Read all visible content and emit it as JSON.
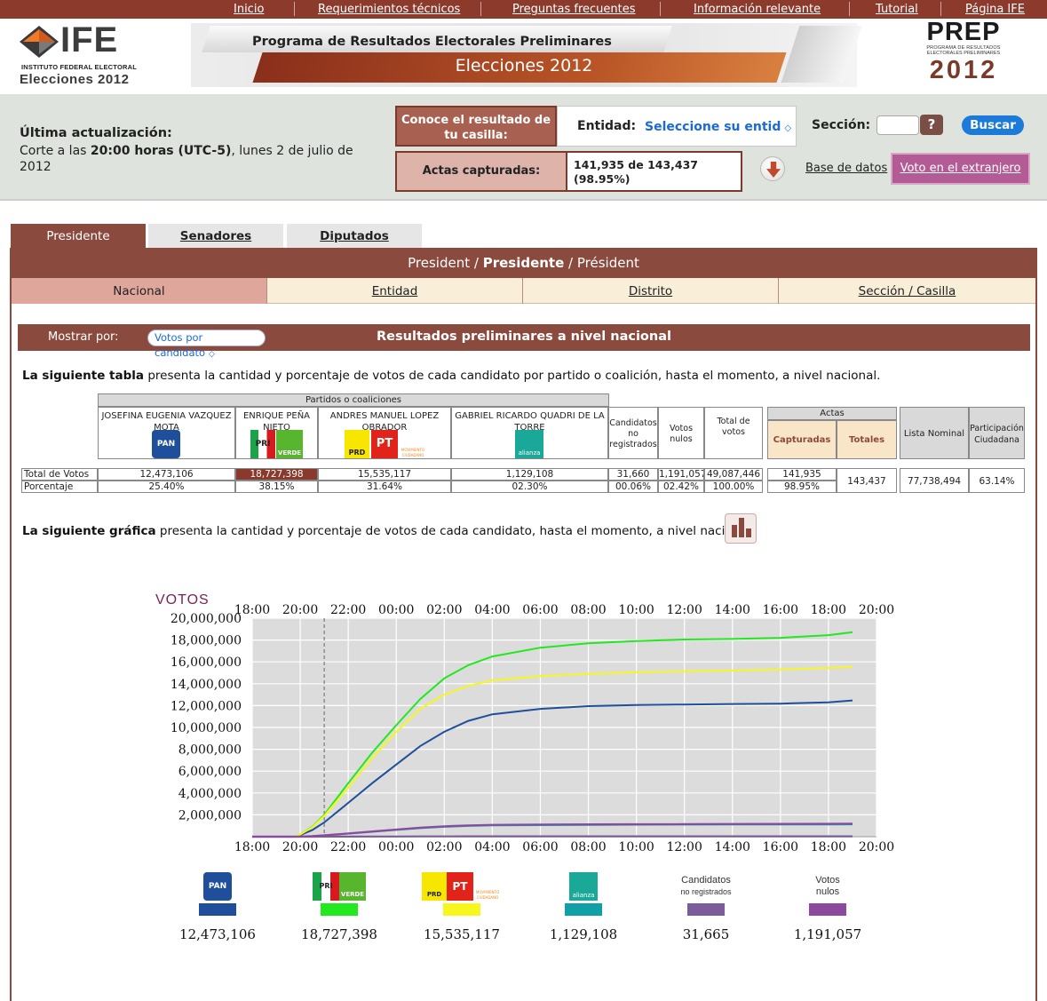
{
  "nav": {
    "inicio": "Inicio",
    "requerimientos": "Requerimientos técnicos",
    "preguntas": "Preguntas frecuentes",
    "informacion": "Información relevante",
    "tutorial": "Tutorial",
    "pagina_ife": "Página IFE"
  },
  "header": {
    "ife_logo_text": "IFE",
    "ife_subtitle": "INSTITUTO FEDERAL ELECTORAL",
    "ife_year": "Elecciones 2012",
    "banner_title": "Programa de Resultados Electorales Preliminares",
    "banner_subtitle": "Elecciones 2012",
    "prep_word": "PREP",
    "prep_sub1": "PROGRAMA DE RESULTADOS",
    "prep_sub2": "ELECTORALES PRELIMINARES",
    "prep_year": "2012"
  },
  "status": {
    "title": "Última actualización:",
    "corte_prefix": "Corte a las ",
    "hora": "20:00 horas (UTC-5)",
    "fecha": ", lunes 2 de julio de 2012",
    "conoce": "Conoce el resultado de tu casilla:",
    "entidad_label": "Entidad:",
    "entidad_select": "Seleccione su entid",
    "seccion_label": "Sección:",
    "help": "?",
    "buscar": "Buscar",
    "actas_label": "Actas capturadas:",
    "actas_value": "141,935 de 143,437",
    "actas_pct": "(98.95%)",
    "base_datos": "Base de datos",
    "voto_extranjero": "Voto en el extranjero"
  },
  "tabs": [
    "Presidente",
    "Senadores",
    "Diputados"
  ],
  "pres_header": {
    "a": "President / ",
    "b": "Presidente",
    "c": " / Président"
  },
  "subtabs": [
    "Nacional",
    "Entidad",
    "Distrito",
    "Sección / Casilla"
  ],
  "results_bar": {
    "mostrar_label": "Mostrar por:",
    "mostrar_value": "Votos por candidato",
    "title": "Resultados preliminares a nivel nacional"
  },
  "intro_table": {
    "bold": "La siguiente tabla",
    "rest": " presenta la cantidad y porcentaje de votos de cada candidato por partido o coalición, hasta el momento, a nivel nacional."
  },
  "intro_chart": {
    "bold": "La siguiente gráfica",
    "rest": " presenta la cantidad y porcentaje de votos de cada candidato, hasta el momento, a nivel nacional."
  },
  "table": {
    "group_header": "Partidos o coaliciones",
    "actas_header": "Actas",
    "candidates": [
      {
        "name": "JOSEFINA EUGENIA VAZQUEZ MOTA",
        "votes": "12,473,106",
        "pct": "25.40%"
      },
      {
        "name": "ENRIQUE PEÑA NIETO",
        "votes": "18,727,398",
        "pct": "38.15%"
      },
      {
        "name": "ANDRES MANUEL LOPEZ OBRADOR",
        "votes": "15,535,117",
        "pct": "31.64%"
      },
      {
        "name": "GABRIEL RICARDO QUADRI DE LA TORRE",
        "votes": "1,129,108",
        "pct": "02.30%"
      }
    ],
    "no_registrados": {
      "label": "Candidatos no registrados",
      "votes": "31,660",
      "pct": "00.06%"
    },
    "nulos": {
      "label": "Votos nulos",
      "votes": "1,191,057",
      "pct": "02.42%"
    },
    "total": {
      "label": "Total de votos",
      "votes": "49,087,446",
      "pct": "100.00%"
    },
    "capturadas": {
      "label": "Capturadas",
      "value": "141,935",
      "pct": "98.95%"
    },
    "totales": {
      "label": "Totales",
      "value": "143,437"
    },
    "lista_nominal": {
      "label": "Lista Nominal",
      "value": "77,738,494"
    },
    "participacion": {
      "label": "Participación Ciudadana",
      "value": "63.14%"
    },
    "row_total_label": "Total de Votos",
    "row_pct_label": "Porcentaje"
  },
  "party_logos": {
    "pan": "PAN",
    "pri": "PRI",
    "verde": "VERDE",
    "prd": "PRD",
    "pt": "PT",
    "mc": "MOVIMIENTO CIUDADANO",
    "alianza": "alianza"
  },
  "colors": {
    "pan": "#1f4f9a",
    "pri": "#22e81e",
    "prd": "#f7f71d",
    "panal": "#12a0a8",
    "no_reg": "#7a5c9a",
    "nulos": "#8a4aa0",
    "brand": "#8a4a3e"
  },
  "chart_data": {
    "type": "line",
    "ylabel": "VOTOS",
    "ylim": [
      0,
      20000000
    ],
    "yticks": [
      "2,000,000",
      "4,000,000",
      "6,000,000",
      "8,000,000",
      "10,000,000",
      "12,000,000",
      "14,000,000",
      "16,000,000",
      "18,000,000",
      "20,000,000"
    ],
    "xticks": [
      "18:00",
      "20:00",
      "22:00",
      "00:00",
      "02:00",
      "04:00",
      "06:00",
      "08:00",
      "10:00",
      "12:00",
      "14:00",
      "16:00",
      "18:00",
      "20:00",
      "22:00"
    ],
    "grid": true,
    "x_hours": [
      0,
      2,
      3.5,
      4,
      5,
      6,
      8,
      10,
      12,
      14,
      16,
      18,
      20,
      24,
      28,
      32,
      36,
      40,
      44,
      48,
      50
    ],
    "series": [
      {
        "values": [
          0,
          0,
          0,
          150000,
          600000,
          1300000,
          3100000,
          4900000,
          6600000,
          8300000,
          9600000,
          10600000,
          11200000,
          11700000,
          11950000,
          12050000,
          12100000,
          12150000,
          12180000,
          12300000,
          12473106
        ],
        "color": "#1f4f9a"
      },
      {
        "values": [
          0,
          0,
          0,
          200000,
          900000,
          2000000,
          4900000,
          7700000,
          10200000,
          12600000,
          14500000,
          15700000,
          16500000,
          17300000,
          17700000,
          17900000,
          18050000,
          18100000,
          18200000,
          18450000,
          18727398
        ],
        "color": "#22e81e"
      },
      {
        "values": [
          0,
          0,
          0,
          200000,
          850000,
          1900000,
          4500000,
          7200000,
          9600000,
          11700000,
          13000000,
          13800000,
          14300000,
          14700000,
          14900000,
          15050000,
          15150000,
          15200000,
          15300000,
          15450000,
          15535117
        ],
        "color": "#f7f71d"
      },
      {
        "values": [
          0,
          0,
          0,
          10000,
          50000,
          120000,
          280000,
          450000,
          620000,
          780000,
          900000,
          980000,
          1030000,
          1060000,
          1080000,
          1095000,
          1105000,
          1110000,
          1115000,
          1120000,
          1129108
        ],
        "color": "#12a0a8"
      },
      {
        "values": [
          0,
          0,
          0,
          0,
          2000,
          5000,
          10000,
          15000,
          20000,
          24000,
          27000,
          29000,
          30000,
          30500,
          31000,
          31200,
          31400,
          31500,
          31600,
          31650,
          31665
        ],
        "color": "#7a5c9a"
      },
      {
        "values": [
          0,
          0,
          0,
          10000,
          50000,
          120000,
          300000,
          480000,
          650000,
          820000,
          950000,
          1030000,
          1080000,
          1110000,
          1130000,
          1140000,
          1150000,
          1160000,
          1170000,
          1180000,
          1191057
        ],
        "color": "#8a4aa0"
      }
    ]
  },
  "legend": [
    {
      "value": "12,473,106"
    },
    {
      "value": "18,727,398"
    },
    {
      "value": "15,535,117"
    },
    {
      "value": "1,129,108"
    },
    {
      "label1": "Candidatos",
      "label2": "no registrados",
      "value": "31,665"
    },
    {
      "label1": "Votos",
      "label2": "nulos",
      "value": "1,191,057"
    }
  ]
}
